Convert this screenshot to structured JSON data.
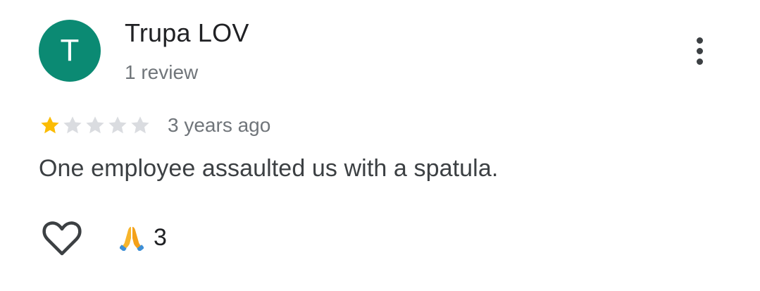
{
  "review": {
    "author": {
      "initial": "T",
      "name": "Trupa LOV",
      "review_count": "1 review",
      "avatar_color": "#0b8a73"
    },
    "more_menu_icon": "more-vert-icon",
    "rating": {
      "value": 1,
      "max": 5,
      "filled_color": "#fbbc04",
      "empty_color": "#dadce0"
    },
    "timestamp": "3 years ago",
    "text": "One employee assaulted us with a spatula.",
    "actions": {
      "like_icon": "heart-outline-icon",
      "reaction_icon": "folded-hands-icon",
      "reaction_count": "3"
    }
  }
}
